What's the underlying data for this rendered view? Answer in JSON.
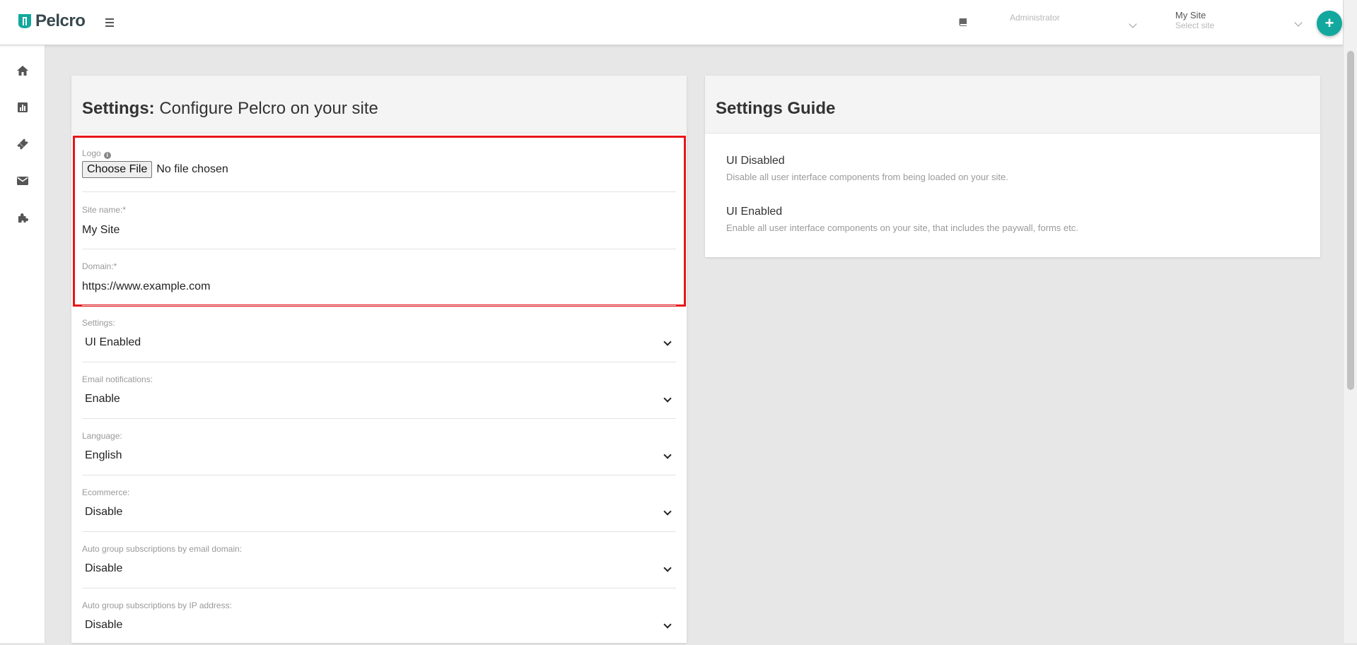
{
  "app": {
    "brand": "Pelcro",
    "brand_color": "#13a89e",
    "accent_color": "#13a89e"
  },
  "header": {
    "role_value": "Administrator",
    "site_name": "My Site",
    "site_placeholder": "Select site",
    "add_label": "+"
  },
  "sidebar": {
    "items": [
      {
        "icon": "home-icon"
      },
      {
        "icon": "bar-chart-icon"
      },
      {
        "icon": "ticket-icon"
      },
      {
        "icon": "envelope-icon"
      },
      {
        "icon": "puzzle-icon"
      }
    ]
  },
  "settings_card": {
    "title_bold": "Settings:",
    "title_rest": " Configure Pelcro on your site",
    "fields": {
      "logo": {
        "label": "Logo",
        "button": "Choose File",
        "status": "No file chosen"
      },
      "site_name": {
        "label": "Site name:*",
        "value": "My Site"
      },
      "domain": {
        "label": "Domain:*",
        "value": "https://www.example.com"
      },
      "settings": {
        "label": "Settings:",
        "value": "UI Enabled"
      },
      "email_notifications": {
        "label": "Email notifications:",
        "value": "Enable"
      },
      "language": {
        "label": "Language:",
        "value": "English"
      },
      "ecommerce": {
        "label": "Ecommerce:",
        "value": "Disable"
      },
      "auto_group_email": {
        "label": "Auto group subscriptions by email domain:",
        "value": "Disable"
      },
      "auto_group_ip": {
        "label": "Auto group subscriptions by IP address:",
        "value": "Disable"
      }
    }
  },
  "guide_card": {
    "title": "Settings Guide",
    "items": [
      {
        "title": "UI Disabled",
        "desc": "Disable all user interface components from being loaded on your site."
      },
      {
        "title": "UI Enabled",
        "desc": "Enable all user interface components on your site, that includes the paywall, forms etc."
      }
    ]
  }
}
